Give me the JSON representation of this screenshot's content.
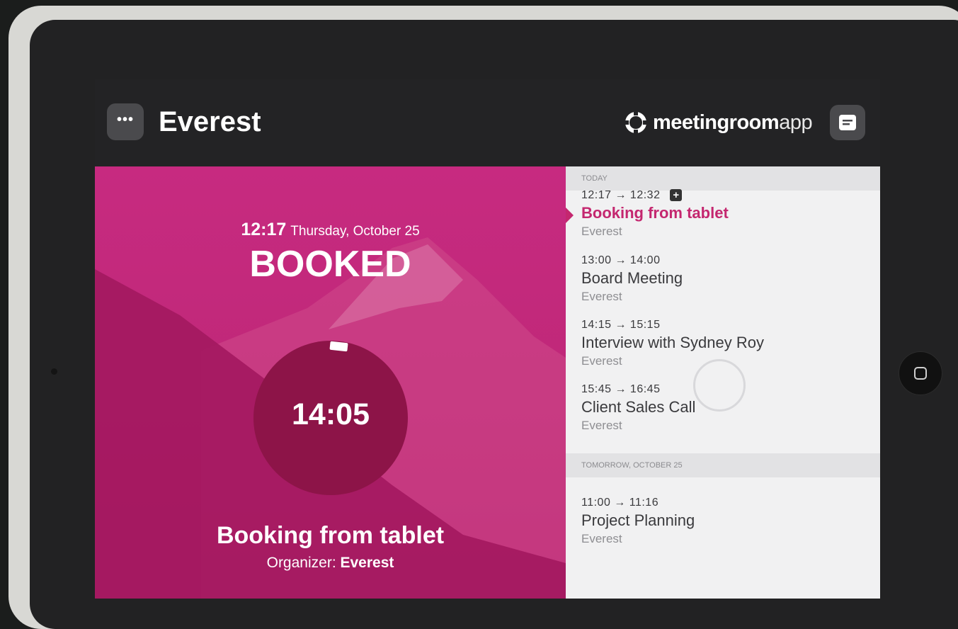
{
  "header": {
    "room_name": "Everest",
    "menu_label": "•••",
    "brand_bold": "meetingroom",
    "brand_light": "app"
  },
  "status": {
    "time": "12:17",
    "date": "Thursday, October 25",
    "state": "BOOKED",
    "countdown": "14:05",
    "booking_title": "Booking from tablet",
    "organizer_label": "Organizer:",
    "organizer_name": "Everest"
  },
  "schedule": {
    "today_label": "TODAY",
    "tomorrow_label": "TOMORROW, OCTOBER 25",
    "today": [
      {
        "time": "12:17 → 12:32",
        "title": "Booking from tablet",
        "location": "Everest",
        "badge": "+"
      },
      {
        "time": "13:00 → 14:00",
        "title": "Board Meeting",
        "location": "Everest"
      },
      {
        "time": "14:15 → 15:15",
        "title": "Interview with Sydney Roy",
        "location": "Everest"
      },
      {
        "time": "15:45 → 16:45",
        "title": "Client Sales Call",
        "location": "Everest"
      }
    ],
    "tomorrow": [
      {
        "time": "11:00 → 11:16",
        "title": "Project Planning",
        "location": "Everest"
      }
    ]
  },
  "colors": {
    "accent": "#c4276f",
    "panel": "#bf2878",
    "timer": "#8d1448"
  },
  "icons": [
    "more-icon",
    "brand-logo-icon",
    "calendar-icon",
    "add-icon",
    "home-button-icon"
  ]
}
